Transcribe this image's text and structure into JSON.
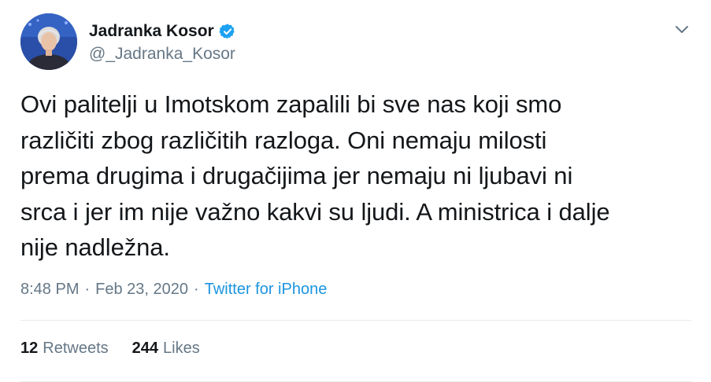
{
  "author": {
    "display_name": "Jadranka Kosor",
    "handle": "@_Jadranka_Kosor",
    "verified_icon": "verified-badge-icon"
  },
  "tweet": {
    "text": "Ovi palitelji u Imotskom zapalili bi sve nas koji smo\nrazličiti zbog različitih razloga. Oni nemaju milosti\nprema drugima i drugačijima jer nemaju ni ljubavi ni\nsrca i jer im nije važno kakvi su ljudi. A ministrica i dalje\nnije nadležna.",
    "time": "8:48 PM",
    "date": "Feb 23, 2020",
    "separator": "·",
    "source": "Twitter for iPhone"
  },
  "stats": {
    "retweets_count": "12",
    "retweets_label": "Retweets",
    "likes_count": "244",
    "likes_label": "Likes"
  },
  "colors": {
    "text_primary": "#14171a",
    "text_secondary": "#657786",
    "link": "#1b95e0",
    "verified": "#1da1f2",
    "divider": "#e6ecf0"
  }
}
